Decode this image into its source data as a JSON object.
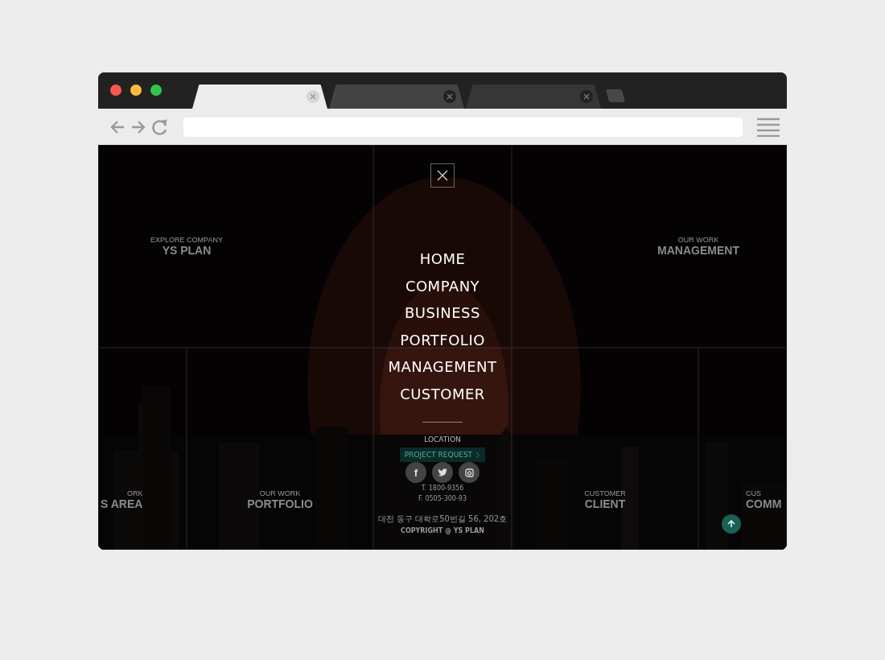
{
  "browser": {
    "tabs": [
      {
        "selected": true
      },
      {
        "selected": false
      },
      {
        "selected": false
      }
    ]
  },
  "site": {
    "tiles": [
      {
        "eyebrow": "EXPLORE COMPANY",
        "title": "YS PLAN"
      },
      {
        "eyebrow": "OUR WORK",
        "title": "MANAGEMENT"
      },
      {
        "eyebrow": "ORK",
        "title": "S AREA"
      },
      {
        "eyebrow": "OUR WORK",
        "title": "PORTFOLIO"
      },
      {
        "eyebrow": "CUSTOMER",
        "title": "CLIENT"
      },
      {
        "eyebrow": "CUS",
        "title": "COMM"
      }
    ],
    "footer": {
      "request": "PROJECT REQUEST",
      "phone": "T. 1800-9356",
      "fax": "F. 0505-300-93",
      "address": "대전 동구 대학로50번길 56, 202호",
      "copyright": "COPYRIGHT @ YS PLAN"
    }
  },
  "menu": {
    "items": [
      "HOME",
      "COMPANY",
      "BUSINESS",
      "PORTFOLIO",
      "MANAGEMENT",
      "CUSTOMER"
    ],
    "location": "LOCATION",
    "social": [
      {
        "kind": "facebook",
        "glyph": "f"
      },
      {
        "kind": "twitter"
      },
      {
        "kind": "instagram"
      }
    ]
  }
}
